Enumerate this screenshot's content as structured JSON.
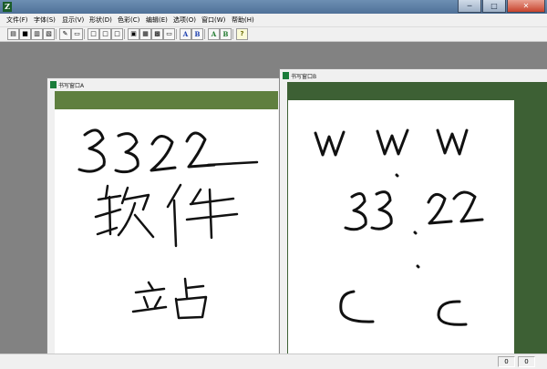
{
  "app": {
    "icon_glyph": "Z",
    "window_buttons": {
      "minimize": "─",
      "maximize": "□",
      "close": "✕"
    }
  },
  "menu": [
    {
      "label": "文件(F)"
    },
    {
      "label": "字体(S)"
    },
    {
      "label": "显示(V)"
    },
    {
      "label": "形状(D)"
    },
    {
      "label": "色彩(C)"
    },
    {
      "label": "编辑(E)"
    },
    {
      "label": "选项(O)"
    },
    {
      "label": "窗口(W)"
    },
    {
      "label": "帮助(H)"
    }
  ],
  "toolbar": {
    "buttons": [
      {
        "name": "open-icon",
        "glyph": "▤"
      },
      {
        "name": "save-icon",
        "glyph": "■"
      },
      {
        "name": "print-icon",
        "glyph": "▥"
      },
      {
        "name": "print-preview-icon",
        "glyph": "▧"
      },
      {
        "name": "pen-icon",
        "glyph": "✎"
      },
      {
        "name": "single-page-icon",
        "glyph": "▭"
      },
      {
        "name": "frame-a-icon",
        "glyph": "□"
      },
      {
        "name": "frame-b-icon",
        "glyph": "□"
      },
      {
        "name": "frame-c-icon",
        "glyph": "□"
      },
      {
        "name": "copy-icon",
        "glyph": "▣"
      },
      {
        "name": "paste-icon",
        "glyph": "▦"
      },
      {
        "name": "clipboard-icon",
        "glyph": "▩"
      },
      {
        "name": "window-icon",
        "glyph": "▭"
      },
      {
        "name": "font-a-blue-icon",
        "glyph": "A"
      },
      {
        "name": "font-b-blue-icon",
        "glyph": "B"
      },
      {
        "name": "font-a-green-icon",
        "glyph": "A"
      },
      {
        "name": "font-b-green-icon",
        "glyph": "B"
      },
      {
        "name": "help-icon",
        "glyph": "?"
      }
    ]
  },
  "windows": {
    "a": {
      "title": "书写窗口A",
      "icon_glyph": "Z"
    },
    "b": {
      "title": "书写窗口B",
      "icon_glyph": "Z"
    }
  },
  "status": {
    "cells": [
      "0",
      "0"
    ]
  },
  "colors": {
    "accent": "#5f7f3f",
    "band_b": "#3d6034",
    "workspace": "#828282"
  }
}
